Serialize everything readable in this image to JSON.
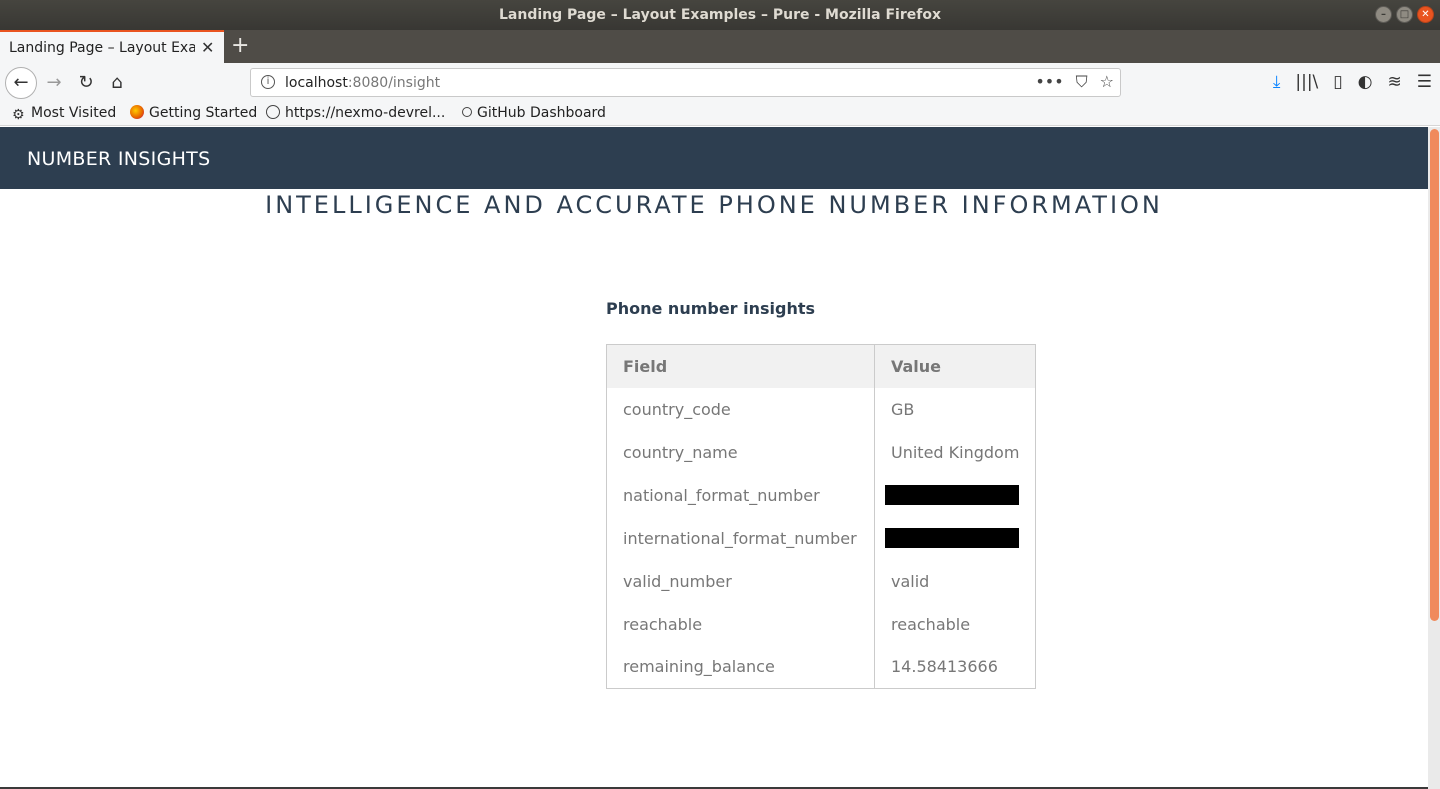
{
  "window": {
    "title": "Landing Page – Layout Examples – Pure - Mozilla Firefox",
    "minimize": "–",
    "maximize": "□",
    "close": "✕"
  },
  "tab": {
    "title": "Landing Page – Layout Examples",
    "close": "✕",
    "new_tab": "+"
  },
  "nav": {
    "back": "←",
    "forward": "→",
    "reload": "↻",
    "home": "⌂",
    "url_host": "localhost",
    "url_rest": ":8080/insight",
    "page_actions": "•••",
    "pocket": "⛉",
    "bookmark_star": "☆",
    "download": "⤓",
    "library": "|||\\",
    "sidebar": "▯",
    "extension": "◐",
    "layers": "≋",
    "menu": "☰"
  },
  "bookmarks": [
    {
      "label": "Most Visited",
      "icon": "gear-icon"
    },
    {
      "label": "Getting Started",
      "icon": "firefox-icon"
    },
    {
      "label": "https://nexmo-devrel...",
      "icon": "globe-icon"
    },
    {
      "label": "GitHub Dashboard",
      "icon": "github-icon"
    }
  ],
  "page": {
    "brand": "NUMBER INSIGHTS",
    "tagline": "INTELLIGENCE AND ACCURATE PHONE NUMBER INFORMATION",
    "section_title": "Phone number insights",
    "table": {
      "headers": [
        "Field",
        "Value"
      ],
      "rows": [
        {
          "field": "country_code",
          "value": "GB",
          "redacted": false
        },
        {
          "field": "country_name",
          "value": "United Kingdom",
          "redacted": false
        },
        {
          "field": "national_format_number",
          "value": "",
          "redacted": true
        },
        {
          "field": "international_format_number",
          "value": "",
          "redacted": true
        },
        {
          "field": "valid_number",
          "value": "valid",
          "redacted": false
        },
        {
          "field": "reachable",
          "value": "reachable",
          "redacted": false
        },
        {
          "field": "remaining_balance",
          "value": "14.58413666",
          "redacted": false
        }
      ]
    }
  },
  "colors": {
    "header_bg": "#2d3e50",
    "accent": "#e95420",
    "scroll_thumb": "#f08a5d"
  }
}
